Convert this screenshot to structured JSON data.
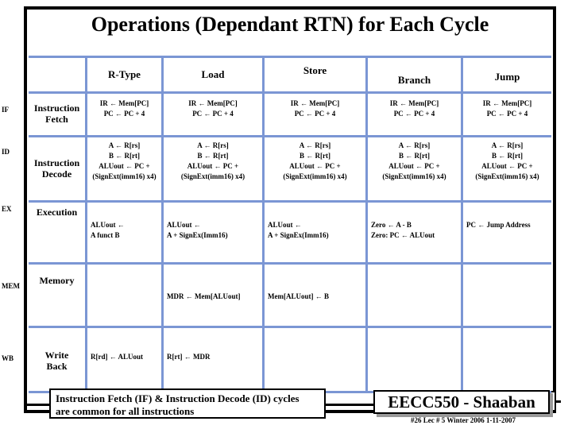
{
  "slide": {
    "title": "Operations (Dependant RTN) for Each Cycle"
  },
  "table": {
    "corner_header": "",
    "columns": [
      {
        "key": "rtype",
        "label": "R-Type"
      },
      {
        "key": "load",
        "label": "Load"
      },
      {
        "key": "store",
        "label": "Store"
      },
      {
        "key": "branch",
        "label": "Branch"
      },
      {
        "key": "jump",
        "label": "Jump"
      }
    ],
    "stage_labels": [
      "IF",
      "ID",
      "EX",
      "MEM",
      "WB"
    ],
    "rows": [
      {
        "stage_abbrev": "IF",
        "stage_name_line1": "Instruction",
        "stage_name_line2": "Fetch",
        "cells": {
          "rtype": [
            "IR ←  Mem[PC]",
            "PC ←  PC + 4"
          ],
          "load": [
            "IR ←  Mem[PC]",
            "PC ←  PC + 4"
          ],
          "store": [
            "IR ←  Mem[PC]",
            "PC ←  PC + 4"
          ],
          "branch": [
            "IR ←  Mem[PC]",
            "PC ←  PC + 4"
          ],
          "jump": [
            "IR ←  Mem[PC]",
            "PC ←  PC + 4"
          ]
        }
      },
      {
        "stage_abbrev": "ID",
        "stage_name_line1": "Instruction",
        "stage_name_line2": "Decode",
        "cells": {
          "rtype": [
            "A ←   R[rs]",
            "B ←   R[rt]",
            "ALUout ←  PC +",
            "(SignExt(imm16) x4)"
          ],
          "load": [
            "A ←   R[rs]",
            "B ←   R[rt]",
            "ALUout ←  PC +",
            "(SignExt(imm16) x4)"
          ],
          "store": [
            "A ←   R[rs]",
            "B ←   R[rt]",
            "ALUout ←  PC +",
            "(SignExt(imm16) x4)"
          ],
          "branch": [
            "A ←   R[rs]",
            "B ←   R[rt]",
            "ALUout ←  PC +",
            "(SignExt(imm16) x4)"
          ],
          "jump": [
            "A ←   R[rs]",
            "B ←   R[rt]",
            "ALUout ←  PC +",
            "(SignExt(imm16) x4)"
          ]
        }
      },
      {
        "stage_abbrev": "EX",
        "stage_name_line1": "Execution",
        "stage_name_line2": "",
        "cells": {
          "rtype": [
            "ALUout ←",
            "      A funct  B"
          ],
          "load": [
            "ALUout ←",
            "   A + SignEx(Imm16)"
          ],
          "store": [
            "ALUout ←",
            "   A + SignEx(Imm16)"
          ],
          "branch": [
            "Zero ← A - B",
            "Zero:  PC ←    ALUout"
          ],
          "jump": [
            "PC  ←  Jump Address"
          ]
        }
      },
      {
        "stage_abbrev": "MEM",
        "stage_name_line1": "Memory",
        "stage_name_line2": "",
        "cells": {
          "rtype": [],
          "load": [
            "MDR ←   Mem[ALUout]"
          ],
          "store": [
            "Mem[ALUout]  ←  B"
          ],
          "branch": [],
          "jump": []
        }
      },
      {
        "stage_abbrev": "WB",
        "stage_name_line1": "Write",
        "stage_name_line2": "Back",
        "cells": {
          "rtype": [
            "R[rd] ← ALUout"
          ],
          "load": [
            "R[rt]  ←   MDR"
          ],
          "store": [],
          "branch": [],
          "jump": []
        }
      }
    ]
  },
  "note": {
    "line1": "Instruction Fetch (IF) & Instruction Decode (ID) cycles",
    "line2": "are common for all instructions"
  },
  "footer": {
    "brand": "EECC550 - Shaaban",
    "meta": "#26   Lec # 5  Winter 2006  1-11-2007"
  },
  "colors": {
    "grid_line": "#7b96d4",
    "frame": "#000000",
    "text": "#000000",
    "brand_shadow": "#999999"
  }
}
